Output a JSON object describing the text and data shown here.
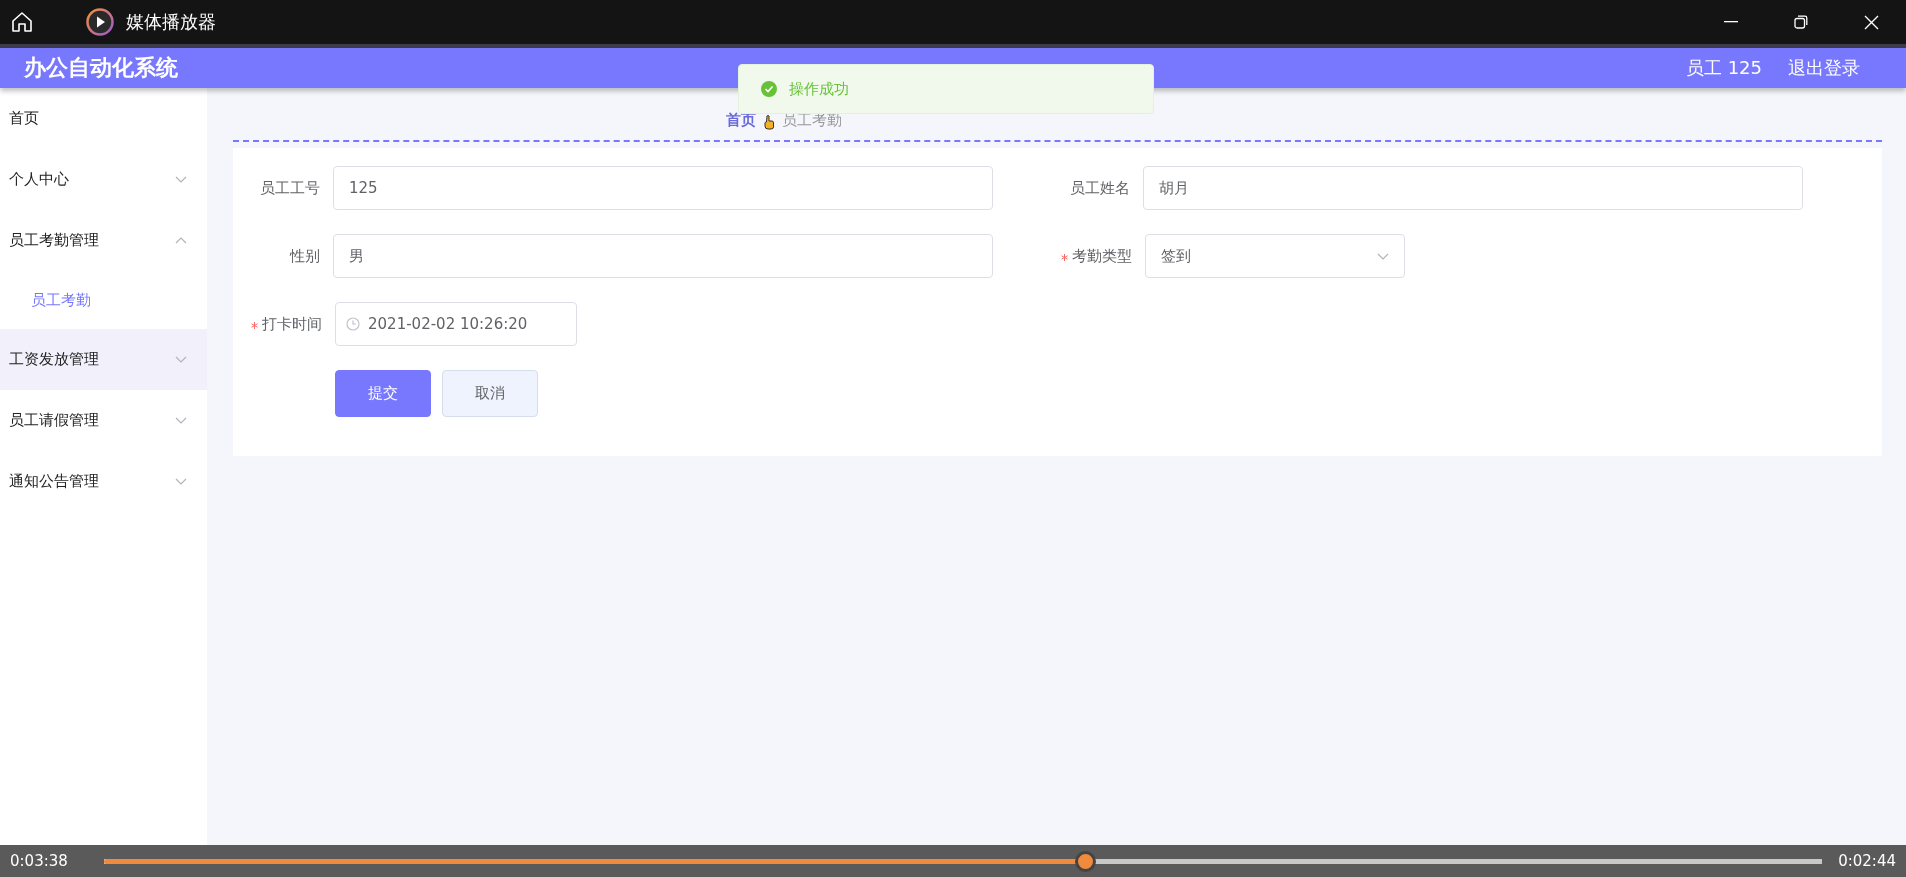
{
  "player": {
    "title": "媒体播放器",
    "elapsed": "0:03:38",
    "remaining": "0:02:44",
    "level": 0.571
  },
  "app": {
    "title": "办公自动化系统",
    "user": "员工 125",
    "logout": "退出登录"
  },
  "sidebar": {
    "items": [
      {
        "label": "首页",
        "hovered": false
      },
      {
        "label": "个人中心",
        "expanded": false,
        "hovered": false
      },
      {
        "label": "员工考勤管理",
        "expanded": true,
        "hovered": false,
        "children": [
          {
            "label": "员工考勤",
            "selected": true
          }
        ]
      },
      {
        "label": "工资发放管理",
        "expanded": false,
        "hovered": true
      },
      {
        "label": "员工请假管理",
        "expanded": false,
        "hovered": false
      },
      {
        "label": "通知公告管理",
        "expanded": false,
        "hovered": false
      }
    ]
  },
  "toast": {
    "message": "操作成功"
  },
  "breadcrumb": [
    "首页",
    "员工考勤"
  ],
  "form": {
    "fields": [
      {
        "label": "员工工号",
        "value": "125",
        "required": false,
        "kind": "text"
      },
      {
        "label": "员工姓名",
        "value": "胡月",
        "required": false,
        "kind": "text"
      },
      {
        "label": "性别",
        "value": "男",
        "required": false,
        "kind": "text"
      },
      {
        "label": "考勤类型",
        "value": "签到",
        "required": true,
        "kind": "select"
      },
      {
        "label": "打卡时间",
        "value": "2021-02-02 10:26:20",
        "required": true,
        "kind": "date"
      }
    ],
    "buttons": [
      {
        "label": "提交",
        "kind": "primary"
      },
      {
        "label": "取消",
        "kind": "default"
      }
    ]
  }
}
